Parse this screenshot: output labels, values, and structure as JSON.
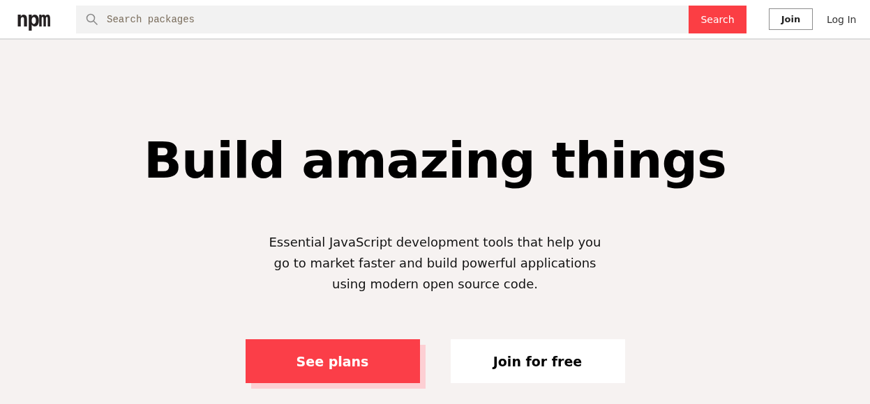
{
  "header": {
    "logo": "npm",
    "search": {
      "placeholder": "Search packages",
      "button": "Search"
    },
    "join": "Join",
    "login": "Log In"
  },
  "hero": {
    "title": "Build amazing things",
    "lines": [
      "Essential JavaScript development tools that help you",
      "go to market faster and build powerful applications",
      "using modern open source code."
    ],
    "buttons": [
      {
        "label": "See plans",
        "kind": "primary"
      },
      {
        "label": "Join for free",
        "kind": "secondary"
      }
    ]
  }
}
